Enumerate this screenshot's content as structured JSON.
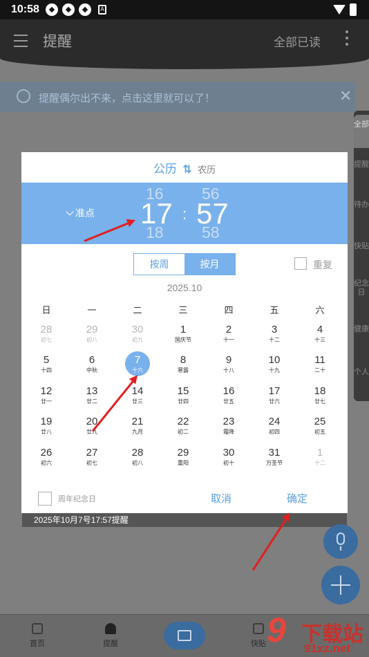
{
  "status_bar": {
    "time": "10:58",
    "badge": "A"
  },
  "app_bar": {
    "title": "提醒",
    "mark_all_read": "全部已读"
  },
  "tip": {
    "text": "提醒偶尔出不来，点击这里就可以了！",
    "close": "✕"
  },
  "side_tabs": [
    "全部",
    "提醒",
    "待办",
    "快贴",
    "纪念日",
    "健康",
    "个人"
  ],
  "dialog": {
    "calendar_solar": "公历",
    "calendar_swap": "⇅",
    "calendar_lunar": "农历",
    "precise_label": "准点",
    "hour_prev": "16",
    "hour_current": "17",
    "hour_next": "18",
    "minute_prev": "56",
    "minute_current": "57",
    "minute_next": "58",
    "colon": ":",
    "mode_week": "按周",
    "mode_month": "按月",
    "repeat_label": "重复",
    "month_title": "2025.10",
    "weekdays": [
      "日",
      "一",
      "二",
      "三",
      "四",
      "五",
      "六"
    ],
    "weeks": [
      [
        {
          "d": "28",
          "s": "初七",
          "o": true
        },
        {
          "d": "29",
          "s": "初八",
          "o": true
        },
        {
          "d": "30",
          "s": "初九",
          "o": true
        },
        {
          "d": "1",
          "s": "国庆节"
        },
        {
          "d": "2",
          "s": "十一"
        },
        {
          "d": "3",
          "s": "十二"
        },
        {
          "d": "4",
          "s": "十三"
        }
      ],
      [
        {
          "d": "5",
          "s": "十四"
        },
        {
          "d": "6",
          "s": "中秋"
        },
        {
          "d": "7",
          "s": "十六",
          "sel": true
        },
        {
          "d": "8",
          "s": "寒露"
        },
        {
          "d": "9",
          "s": "十八"
        },
        {
          "d": "10",
          "s": "十九"
        },
        {
          "d": "11",
          "s": "二十"
        }
      ],
      [
        {
          "d": "12",
          "s": "廿一"
        },
        {
          "d": "13",
          "s": "廿二"
        },
        {
          "d": "14",
          "s": "廿三"
        },
        {
          "d": "15",
          "s": "廿四"
        },
        {
          "d": "16",
          "s": "廿五"
        },
        {
          "d": "17",
          "s": "廿六"
        },
        {
          "d": "18",
          "s": "廿七"
        }
      ],
      [
        {
          "d": "19",
          "s": "廿八"
        },
        {
          "d": "20",
          "s": "廿九"
        },
        {
          "d": "21",
          "s": "九月"
        },
        {
          "d": "22",
          "s": "初二"
        },
        {
          "d": "23",
          "s": "霜降"
        },
        {
          "d": "24",
          "s": "初四"
        },
        {
          "d": "25",
          "s": "初五"
        }
      ],
      [
        {
          "d": "26",
          "s": "初六"
        },
        {
          "d": "27",
          "s": "初七"
        },
        {
          "d": "28",
          "s": "初八"
        },
        {
          "d": "29",
          "s": "重阳"
        },
        {
          "d": "30",
          "s": "初十"
        },
        {
          "d": "31",
          "s": "万圣节"
        },
        {
          "d": "1",
          "s": "十二",
          "o": true
        }
      ]
    ],
    "anniversary_label": "周年纪念日",
    "cancel": "取消",
    "confirm": "确定"
  },
  "reminder_text": "2025年10月7号17:57提醒",
  "bottom_nav": {
    "home": "首页",
    "remind": "提醒",
    "fourth": "快贴"
  },
  "watermark": {
    "big": "9",
    "cn": "下载站",
    "url": "91xz.net"
  },
  "colors": {
    "accent": "#79b1ec",
    "link": "#5a9ee0",
    "arrow": "#e02020"
  }
}
